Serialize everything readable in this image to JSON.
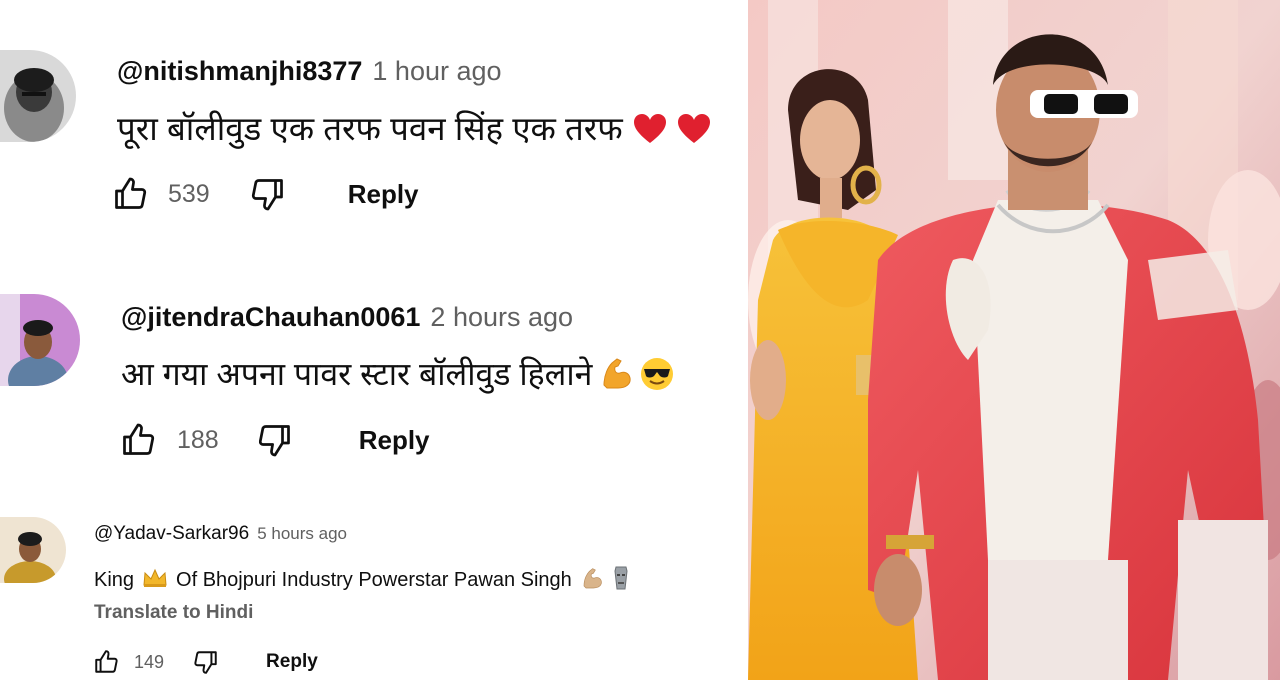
{
  "comments": [
    {
      "handle": "@nitishmanjhi8377",
      "time": "1 hour ago",
      "text": "पूरा बॉलीवुड एक तरफ पवन सिंह एक तरफ",
      "emojis": [
        "red-heart",
        "red-heart"
      ],
      "likes": "539",
      "reply_label": "Reply"
    },
    {
      "handle": "@jitendraChauhan0061",
      "time": "2 hours ago",
      "text": "आ गया अपना पावर स्टार बॉलीवुड हिलाने",
      "emojis": [
        "flexed-biceps",
        "sunglasses-face"
      ],
      "likes": "188",
      "reply_label": "Reply"
    },
    {
      "handle": "@Yadav-Sarkar96",
      "time": "5 hours ago",
      "text_before": "King",
      "text_after": "Of Bhojpuri Industry Powerstar Pawan Singh",
      "emojis": [
        "crown",
        "flexed-biceps",
        "moai"
      ],
      "translate_label": "Translate to Hindi",
      "likes": "149",
      "reply_label": "Reply"
    }
  ],
  "icons": [
    "like-icon",
    "dislike-icon"
  ],
  "colors": {
    "text": "#0f0f0f",
    "secondary": "#606060",
    "heart": "#e0202f",
    "jacket": "#e8444a",
    "dress": "#f3b21f"
  }
}
